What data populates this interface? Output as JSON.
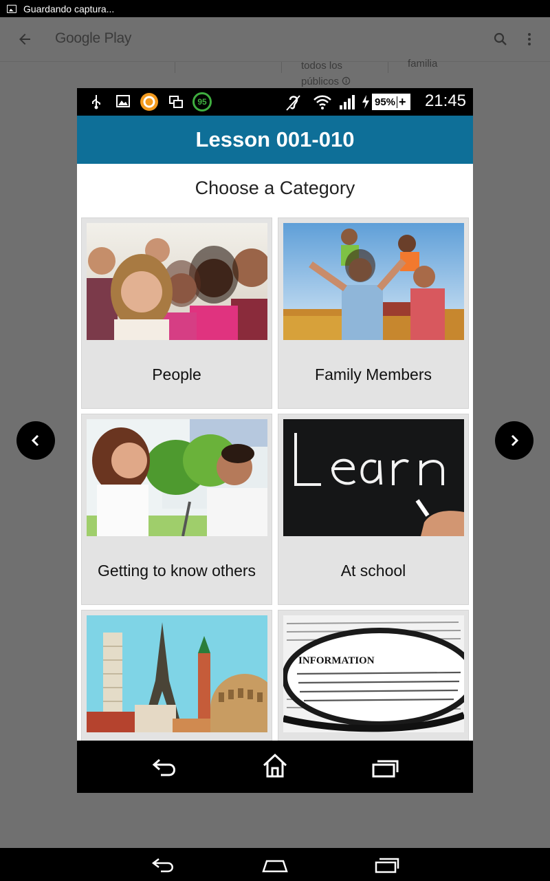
{
  "system_status": {
    "message": "Guardando captura..."
  },
  "background_app": {
    "title": "Google Play",
    "info_text": [
      "todos los",
      "públicos"
    ],
    "info_text_2": "familia"
  },
  "phone": {
    "status": {
      "battery": "95%",
      "time": "21:45",
      "notif_badge": "95"
    },
    "header_title": "Lesson 001-010",
    "subtitle": "Choose a Category",
    "categories": [
      {
        "label": "People",
        "image": "group-of-friends-photo"
      },
      {
        "label": "Family Members",
        "image": "family-photo"
      },
      {
        "label": "Getting to know others",
        "image": "couple-talking-photo"
      },
      {
        "label": "At school",
        "image": "chalkboard-learn-photo"
      },
      {
        "label": "",
        "image": "landmarks-photo"
      },
      {
        "label": "",
        "image": "information-magnifier-photo"
      }
    ]
  },
  "icons": {
    "prev": "chevron-left-icon",
    "next": "chevron-right-icon",
    "back": "back-icon",
    "home": "home-icon",
    "recents": "recents-icon"
  }
}
